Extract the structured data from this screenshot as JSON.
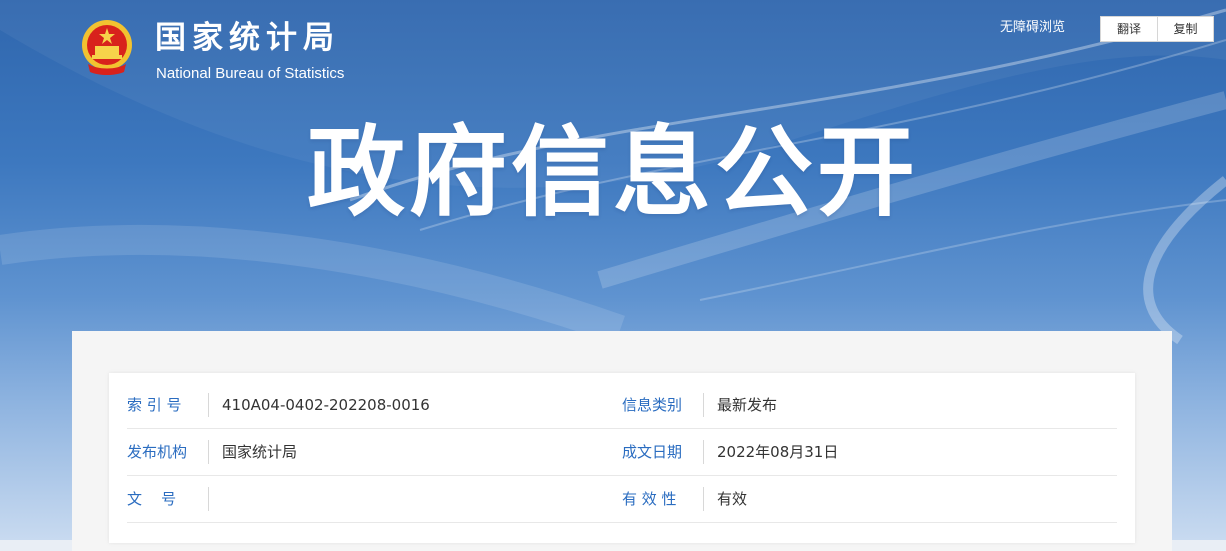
{
  "header": {
    "site_name_cn": "国家统计局",
    "site_name_en": "National Bureau of Statistics",
    "accessibility_label": "无障碍浏览",
    "translate_label": "翻译",
    "copy_label": "复制",
    "emblem_icon": "national-emblem-icon"
  },
  "banner": {
    "title": "政府信息公开"
  },
  "colors": {
    "label_blue": "#2a6cc0",
    "banner_blue": "#2f66ad"
  },
  "info_table": {
    "rows": [
      {
        "left_label": "索 引 号",
        "left_value": "410A04-0402-202208-0016",
        "right_label": "信息类别",
        "right_value": "最新发布"
      },
      {
        "left_label": "发布机构",
        "left_value": "国家统计局",
        "right_label": "成文日期",
        "right_value": "2022年08月31日"
      },
      {
        "left_label": "文    号",
        "left_value": "",
        "right_label": "有 效 性",
        "right_value": "有效"
      }
    ]
  }
}
